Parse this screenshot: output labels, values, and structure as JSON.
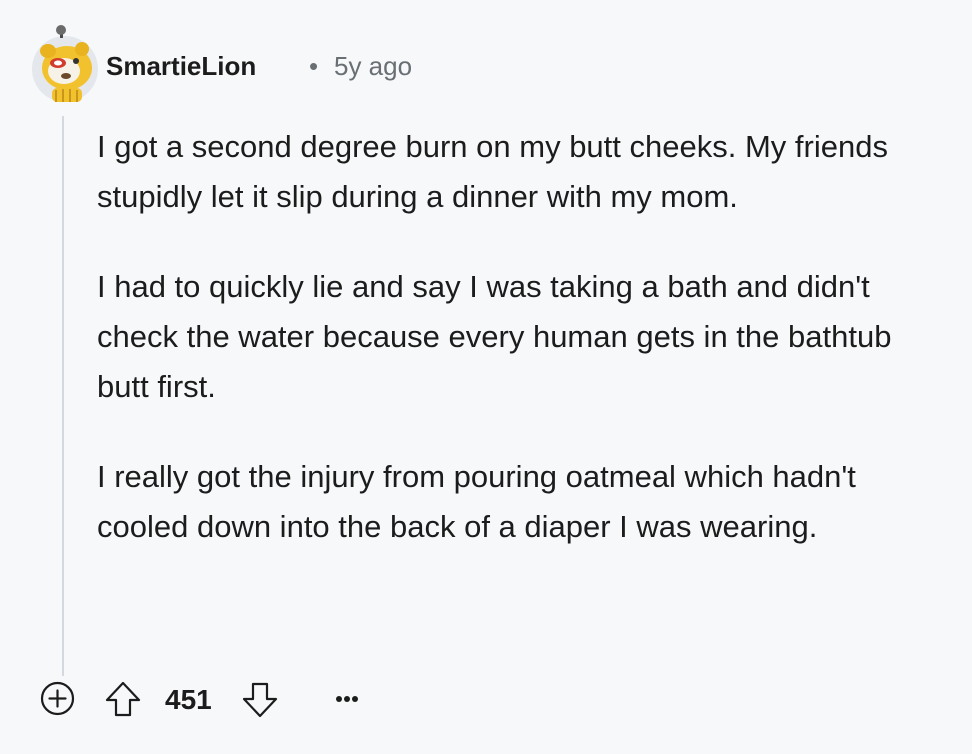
{
  "comment": {
    "author": "SmartieLion",
    "separator": "•",
    "timestamp": "5y ago",
    "paragraphs": [
      "I got a second degree burn on my butt cheeks. My friends stupidly let it slip during a dinner with my mom.",
      "I had to quickly lie and say I was taking a bath and didn't check the water because every human gets in the bathtub butt first.",
      "I really got the injury from pouring oatmeal which hadn't cooled down into the back of a diaper I was wearing."
    ]
  },
  "actions": {
    "score": "451",
    "icons": [
      "expand-icon",
      "upvote-icon",
      "downvote-icon",
      "more-options-icon"
    ]
  },
  "colors": {
    "background": "#f6f8fa",
    "text": "#1c1c1c",
    "meta": "#6a6f73",
    "thread_line": "#d3d9de"
  }
}
